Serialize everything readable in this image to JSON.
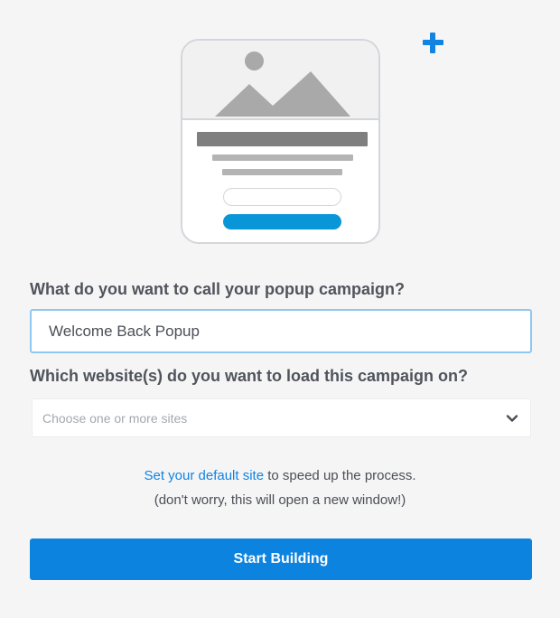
{
  "icons": {
    "add": "plus-icon",
    "dropdown": "chevron-down-icon",
    "illustration": "popup-preview-illustration"
  },
  "colors": {
    "accent": "#1183e2",
    "button": "#0d83e0",
    "background": "#f5f5f6"
  },
  "form": {
    "name_label": "What do you want to call your popup campaign?",
    "name_value": "Welcome Back Popup",
    "sites_label": "Which website(s) do you want to load this campaign on?",
    "sites_placeholder": "Choose one or more sites"
  },
  "hint": {
    "link_text": "Set your default site",
    "line1_rest": " to speed up the process.",
    "line2": "(don't worry, this will open a new window!)"
  },
  "start_button_label": "Start Building"
}
